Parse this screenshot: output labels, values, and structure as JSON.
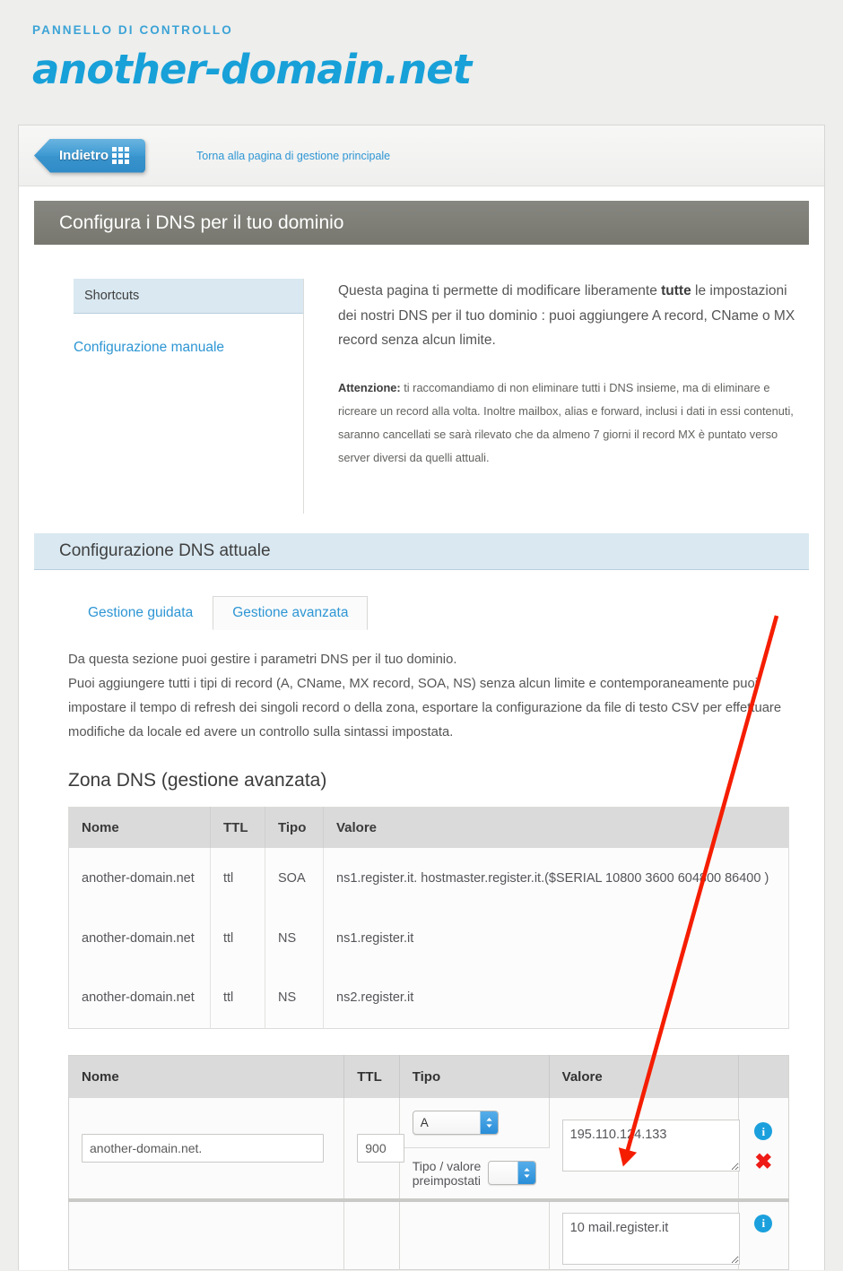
{
  "brand": {
    "kicker": "PANNELLO DI CONTROLLO",
    "domain": "another-domain.net"
  },
  "backbar": {
    "button_label": "Indietro",
    "link_text": "Torna alla pagina di gestione principale"
  },
  "page_title": "Configura i DNS per il tuo dominio",
  "sidebar": {
    "heading": "Shortcuts",
    "links": [
      {
        "label": "Configurazione manuale"
      }
    ]
  },
  "intro": {
    "lead_before": "Questa pagina ti permette di modificare liberamente ",
    "lead_bold": "tutte",
    "lead_after": " le impostazioni dei nostri DNS per il tuo dominio : puoi aggiungere A record, CName o MX record senza alcun limite.",
    "note_bold": "Attenzione:",
    "note_text": " ti raccomandiamo di non eliminare tutti i DNS insieme, ma di eliminare e ricreare un record alla volta. Inoltre mailbox, alias e forward, inclusi i dati in essi contenuti, saranno cancellati se sarà rilevato che da almeno 7 giorni il record MX è puntato verso server diversi da quelli attuali."
  },
  "section": {
    "heading": "Configurazione DNS attuale",
    "tabs": [
      {
        "label": "Gestione guidata",
        "active": false
      },
      {
        "label": "Gestione avanzata",
        "active": true
      }
    ],
    "body_line1": "Da questa sezione puoi gestire i parametri DNS per il tuo dominio.",
    "body_line2": "Puoi aggiungere tutti i tipi di record (A, CName, MX record, SOA, NS) senza alcun limite e contemporaneamente puoi impostare il tempo di refresh dei singoli record o della zona, esportare la configurazione da file di testo CSV per effettuare modifiche da locale ed avere un controllo sulla sintassi impostata.",
    "zone_title": "Zona DNS (gestione avanzata)"
  },
  "zone_table": {
    "headers": [
      "Nome",
      "TTL",
      "Tipo",
      "Valore"
    ],
    "rows": [
      {
        "nome": "another-domain.net",
        "ttl": "ttl",
        "tipo": "SOA",
        "valore": "ns1.register.it. hostmaster.register.it.($SERIAL 10800 3600 604800 86400 )"
      },
      {
        "nome": "another-domain.net",
        "ttl": "ttl",
        "tipo": "NS",
        "valore": "ns1.register.it"
      },
      {
        "nome": "another-domain.net",
        "ttl": "ttl",
        "tipo": "NS",
        "valore": "ns2.register.it"
      }
    ]
  },
  "form_table": {
    "headers": [
      "Nome",
      "TTL",
      "Tipo",
      "Valore",
      ""
    ],
    "preset_label": "Tipo / valore preimpostati",
    "rows": [
      {
        "nome_value": "another-domain.net.",
        "ttl_value": "900",
        "tipo_value": "A",
        "valore_value": "195.110.124.133",
        "preset_value": ""
      },
      {
        "valore_value": "10 mail.register.it"
      }
    ]
  },
  "icons": {
    "info": "i",
    "delete": "✖",
    "select_arrows": "⌃⌄"
  },
  "colors": {
    "brand_blue": "#18a0d8",
    "link_blue": "#2e96d4",
    "section_blue_bg": "#d9e8f1",
    "title_gray": "#7b7b74",
    "annotation_red": "#f51d00",
    "info_blue": "#1ba0dd",
    "delete_red": "#ee1b17"
  }
}
